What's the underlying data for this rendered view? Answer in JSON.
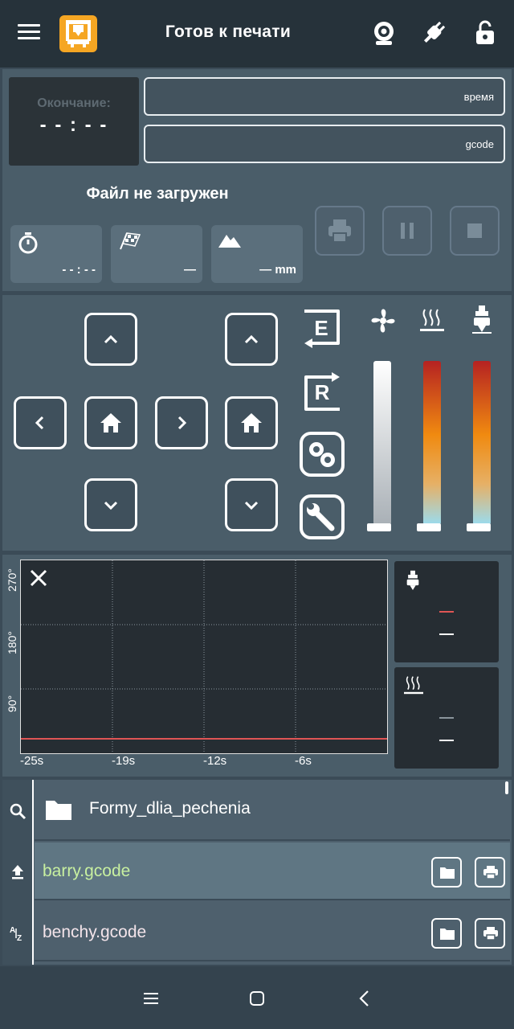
{
  "header": {
    "title": "Готов к печати"
  },
  "status": {
    "eta_label": "Окончание:",
    "eta_value": "- - : - -",
    "time_field": "время",
    "gcode_field": "gcode",
    "file_status": "Файл не загружен",
    "elapsed": "- - : - -",
    "layer": "—",
    "height": "— mm"
  },
  "controls": {
    "extruder_label": "E",
    "retract_label": "R"
  },
  "graph": {
    "y_labels": [
      "270°",
      "180°",
      "90°"
    ],
    "x_labels": [
      "-25s",
      "-19s",
      "-12s",
      "-6s"
    ],
    "nozzle_line_color": "#e05555"
  },
  "temps": {
    "hotend": {
      "target": "—",
      "actual": "—"
    },
    "bed": {
      "target": "—",
      "actual": "—"
    }
  },
  "files": {
    "folder": "Formy_dlia_pechenia",
    "items": [
      {
        "name": "barry.gcode",
        "color": "#c8f0a0"
      },
      {
        "name": "benchy.gcode",
        "color": "#f3e4ea"
      }
    ]
  },
  "colors": {
    "logo": "#f5a623",
    "topbar": "#26323a",
    "panel": "#4a5d69",
    "heater_gradient": [
      "#b52222",
      "#f08a10",
      "#9adcf0"
    ]
  }
}
